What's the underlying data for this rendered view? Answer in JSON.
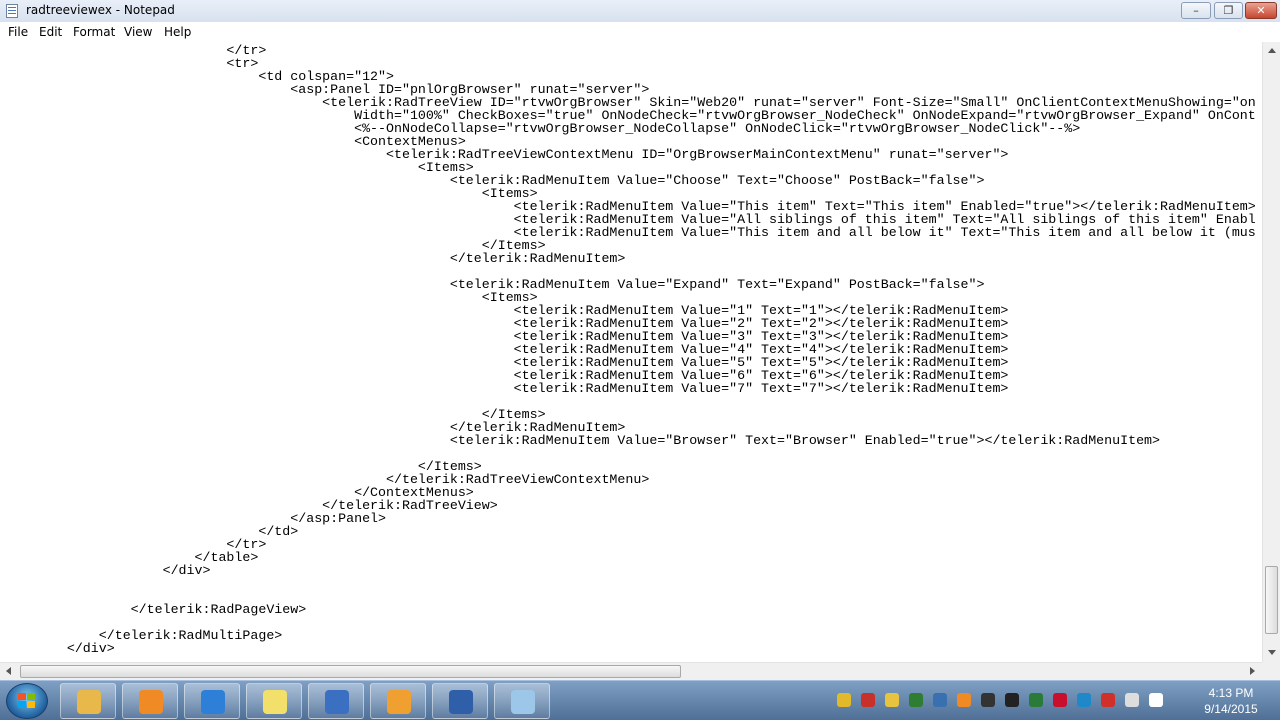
{
  "window": {
    "title": "radtreeviewex - Notepad",
    "minimize_label": "–",
    "maximize_label": "❐",
    "close_label": "✕"
  },
  "menubar": {
    "items": [
      "File",
      "Edit",
      "Format",
      "View",
      "Help"
    ]
  },
  "editor": {
    "lines": [
      "                            </tr>",
      "                            <tr>",
      "                                <td colspan=\"12\">",
      "                                    <asp:Panel ID=\"pnlOrgBrowser\" runat=\"server\">",
      "                                        <telerik:RadTreeView ID=\"rtvwOrgBrowser\" Skin=\"Web20\" runat=\"server\" Font-Size=\"Small\" OnClientContextMenuShowing=\"on",
      "                                            Width=\"100%\" CheckBoxes=\"true\" OnNodeCheck=\"rtvwOrgBrowser_NodeCheck\" OnNodeExpand=\"rtvwOrgBrowser_Expand\" OnCont",
      "                                            <%--OnNodeCollapse=\"rtvwOrgBrowser_NodeCollapse\" OnNodeClick=\"rtvwOrgBrowser_NodeClick\"--%>",
      "                                            <ContextMenus>",
      "                                                <telerik:RadTreeViewContextMenu ID=\"OrgBrowserMainContextMenu\" runat=\"server\">",
      "                                                    <Items>",
      "                                                        <telerik:RadMenuItem Value=\"Choose\" Text=\"Choose\" PostBack=\"false\">",
      "                                                            <Items>",
      "                                                                <telerik:RadMenuItem Value=\"This item\" Text=\"This item\" Enabled=\"true\"></telerik:RadMenuItem>",
      "                                                                <telerik:RadMenuItem Value=\"All siblings of this item\" Text=\"All siblings of this item\" Enabl",
      "                                                                <telerik:RadMenuItem Value=\"This item and all below it\" Text=\"This item and all below it (mus",
      "                                                            </Items>",
      "                                                        </telerik:RadMenuItem>",
      "",
      "                                                        <telerik:RadMenuItem Value=\"Expand\" Text=\"Expand\" PostBack=\"false\">",
      "                                                            <Items>",
      "                                                                <telerik:RadMenuItem Value=\"1\" Text=\"1\"></telerik:RadMenuItem>",
      "                                                                <telerik:RadMenuItem Value=\"2\" Text=\"2\"></telerik:RadMenuItem>",
      "                                                                <telerik:RadMenuItem Value=\"3\" Text=\"3\"></telerik:RadMenuItem>",
      "                                                                <telerik:RadMenuItem Value=\"4\" Text=\"4\"></telerik:RadMenuItem>",
      "                                                                <telerik:RadMenuItem Value=\"5\" Text=\"5\"></telerik:RadMenuItem>",
      "                                                                <telerik:RadMenuItem Value=\"6\" Text=\"6\"></telerik:RadMenuItem>",
      "                                                                <telerik:RadMenuItem Value=\"7\" Text=\"7\"></telerik:RadMenuItem>",
      "",
      "                                                            </Items>",
      "                                                        </telerik:RadMenuItem>",
      "                                                        <telerik:RadMenuItem Value=\"Browser\" Text=\"Browser\" Enabled=\"true\"></telerik:RadMenuItem>",
      "",
      "                                                    </Items>",
      "                                                </telerik:RadTreeViewContextMenu>",
      "                                            </ContextMenus>",
      "                                        </telerik:RadTreeView>",
      "                                    </asp:Panel>",
      "                                </td>",
      "                            </tr>",
      "                        </table>",
      "                    </div>",
      "",
      "",
      "                </telerik:RadPageView>",
      "",
      "            </telerik:RadMultiPage>",
      "        </div>"
    ]
  },
  "taskbar": {
    "apps": [
      {
        "name": "Windows Explorer",
        "icon": "folder-icon",
        "color": "#e8b84a"
      },
      {
        "name": "Windows Media Player",
        "icon": "media-player-icon",
        "color": "#f08a24"
      },
      {
        "name": "Internet Explorer",
        "icon": "internet-explorer-icon",
        "color": "#2d7fd8"
      },
      {
        "name": "Sticky Notes",
        "icon": "sticky-notes-icon",
        "color": "#f2e06a"
      },
      {
        "name": "Communicator",
        "icon": "communicator-icon",
        "color": "#3b6fc2"
      },
      {
        "name": "Outlook",
        "icon": "outlook-icon",
        "color": "#f0a030"
      },
      {
        "name": "Remote Desktop",
        "icon": "remote-desktop-icon",
        "color": "#2f5fa8"
      },
      {
        "name": "Notepad",
        "icon": "notepad-icon",
        "color": "#9cc7e8"
      }
    ],
    "tray_icons": [
      {
        "icon": "shield-icon",
        "color": "#e2b92a"
      },
      {
        "icon": "antivirus-icon",
        "color": "#c8302a"
      },
      {
        "icon": "mail-icon",
        "color": "#e8c340"
      },
      {
        "icon": "network-sync-icon",
        "color": "#2e7d32"
      },
      {
        "icon": "remote-icon",
        "color": "#3a6fb0"
      },
      {
        "icon": "office-icon",
        "color": "#f08a24"
      },
      {
        "icon": "security-icon",
        "color": "#333333"
      },
      {
        "icon": "sync-icon",
        "color": "#222222"
      },
      {
        "icon": "update-icon",
        "color": "#2a7a3a"
      },
      {
        "icon": "pdf-icon",
        "color": "#c8102e"
      },
      {
        "icon": "settings-icon",
        "color": "#1e88c8"
      },
      {
        "icon": "warning-icon",
        "color": "#d0302a"
      },
      {
        "icon": "power-icon",
        "color": "#dddddd"
      },
      {
        "icon": "signal-icon",
        "color": "#ffffff"
      }
    ],
    "clock": {
      "time": "4:13 PM",
      "date": "9/14/2015"
    }
  }
}
